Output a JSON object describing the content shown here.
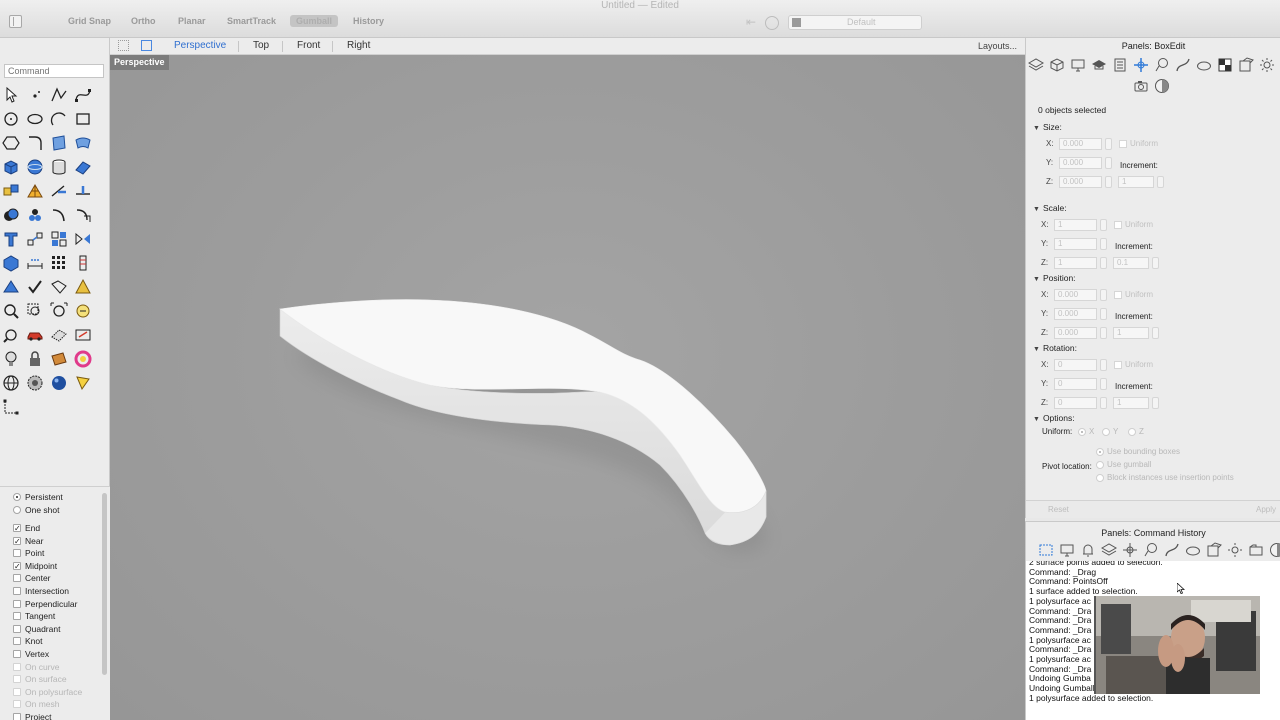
{
  "window": {
    "title": "Untitled",
    "title_suffix": "— Edited"
  },
  "toolbar": {
    "grid_snap": "Grid Snap",
    "ortho": "Ortho",
    "planar": "Planar",
    "smarttrack": "SmartTrack",
    "gumball": "Gumball",
    "history": "History",
    "layer": "Default"
  },
  "viewport_tabs": {
    "perspective": "Perspective",
    "top": "Top",
    "front": "Front",
    "right": "Right",
    "layouts": "Layouts..."
  },
  "viewport": {
    "label": "Perspective",
    "background": "#a0a0a0",
    "object_color": "#f7f7f7"
  },
  "command": {
    "placeholder": "Command"
  },
  "osnap": {
    "mode_persistent": "Persistent",
    "mode_one_shot": "One shot",
    "items": [
      {
        "label": "End",
        "checked": true
      },
      {
        "label": "Near",
        "checked": true
      },
      {
        "label": "Point",
        "checked": false
      },
      {
        "label": "Midpoint",
        "checked": true
      },
      {
        "label": "Center",
        "checked": false
      },
      {
        "label": "Intersection",
        "checked": false
      },
      {
        "label": "Perpendicular",
        "checked": false
      },
      {
        "label": "Tangent",
        "checked": false
      },
      {
        "label": "Quadrant",
        "checked": false
      },
      {
        "label": "Knot",
        "checked": false
      },
      {
        "label": "Vertex",
        "checked": false
      },
      {
        "label": "On curve",
        "checked": false
      },
      {
        "label": "On surface",
        "checked": false
      },
      {
        "label": "On polysurface",
        "checked": false
      },
      {
        "label": "On mesh",
        "checked": false
      },
      {
        "label": "Project",
        "checked": false
      }
    ]
  },
  "box_edit": {
    "title": "Panels: BoxEdit",
    "selected": "0 objects selected",
    "size": {
      "label": "Size:",
      "x": "0.000",
      "y": "0.000",
      "z": "0.000",
      "increment": "1"
    },
    "scale": {
      "label": "Scale:",
      "x": "1",
      "y": "1",
      "z": "1",
      "increment": "0.1"
    },
    "position": {
      "label": "Position:",
      "x": "0.000",
      "y": "0.000",
      "z": "0.000",
      "increment": "1"
    },
    "rotation": {
      "label": "Rotation:",
      "x": "0",
      "y": "0",
      "z": "0",
      "increment": "1"
    },
    "options": {
      "label": "Options:",
      "uniform_label": "Uniform:",
      "uniform_x": "X",
      "uniform_y": "Y",
      "uniform_z": "Z",
      "pivot_label": "Pivot location:",
      "pivot_bbox": "Use bounding boxes",
      "pivot_gumball": "Use gumball",
      "pivot_block": "Block instances use insertion points"
    },
    "uniform": "Uniform",
    "increment": "Increment:",
    "x": "X:",
    "y": "Y:",
    "z": "Z:",
    "reset": "Reset",
    "apply": "Apply"
  },
  "command_history": {
    "title": "Panels: Command History",
    "lines": [
      "2 surface points added to selection.",
      "Command: _Drag",
      "Command: PointsOff",
      "1 surface added to selection.",
      "1 polysurface ac",
      "Command: _Dra",
      "Command: _Dra",
      "Command: _Dra",
      "1 polysurface ac",
      "Command: _Dra",
      "1 polysurface ac",
      "Command: _Dra",
      "Undoing Gumba",
      "Undoing Gumball scale",
      "1 polysurface added to selection."
    ]
  }
}
